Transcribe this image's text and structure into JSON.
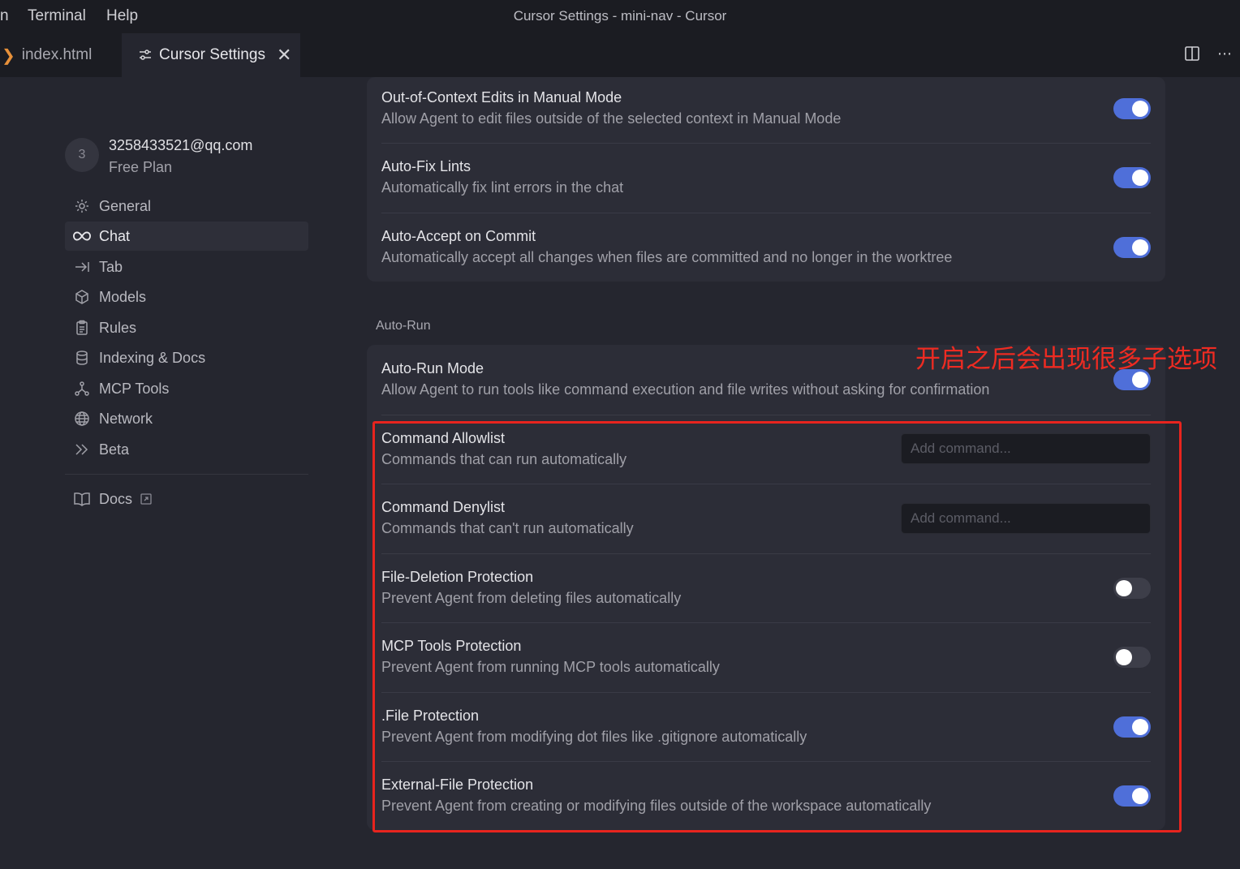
{
  "menu": {
    "fragment": "n",
    "terminal": "Terminal",
    "help": "Help"
  },
  "window_title": "Cursor Settings - mini-nav - Cursor",
  "tabs": [
    {
      "label": "index.html",
      "icon": "chevron-right-icon"
    },
    {
      "label": "Cursor Settings",
      "icon": "sliders-icon",
      "active": true
    }
  ],
  "tab_actions": [
    "split-editor-icon",
    "more-icon"
  ],
  "account": {
    "avatar_initial": "3",
    "email": "3258433521@qq.com",
    "plan": "Free Plan"
  },
  "nav": [
    {
      "label": "General",
      "icon": "gear-icon"
    },
    {
      "label": "Chat",
      "icon": "infinity-icon",
      "active": true
    },
    {
      "label": "Tab",
      "icon": "tab-arrow-icon"
    },
    {
      "label": "Models",
      "icon": "cube-icon"
    },
    {
      "label": "Rules",
      "icon": "clipboard-icon"
    },
    {
      "label": "Indexing & Docs",
      "icon": "database-icon"
    },
    {
      "label": "MCP Tools",
      "icon": "nodes-icon"
    },
    {
      "label": "Network",
      "icon": "globe-icon"
    },
    {
      "label": "Beta",
      "icon": "double-chevron-icon"
    }
  ],
  "docs": {
    "label": "Docs",
    "icon": "book-icon",
    "external_icon": "external-link-icon"
  },
  "top_card": [
    {
      "title": "Out-of-Context Edits in Manual Mode",
      "desc": "Allow Agent to edit files outside of the selected context in Manual Mode",
      "enabled": true
    },
    {
      "title": "Auto-Fix Lints",
      "desc": "Automatically fix lint errors in the chat",
      "enabled": true
    },
    {
      "title": "Auto-Accept on Commit",
      "desc": "Automatically accept all changes when files are committed and no longer in the worktree",
      "enabled": true
    }
  ],
  "auto_run": {
    "section_label": "Auto-Run",
    "mode": {
      "title": "Auto-Run Mode",
      "desc": "Allow Agent to run tools like command execution and file writes without asking for confirmation",
      "enabled": true
    },
    "allowlist": {
      "title": "Command Allowlist",
      "desc": "Commands that can run automatically",
      "placeholder": "Add command..."
    },
    "denylist": {
      "title": "Command Denylist",
      "desc": "Commands that can't run automatically",
      "placeholder": "Add command..."
    },
    "toggles": [
      {
        "title": "File-Deletion Protection",
        "desc": "Prevent Agent from deleting files automatically",
        "enabled": false
      },
      {
        "title": "MCP Tools Protection",
        "desc": "Prevent Agent from running MCP tools automatically",
        "enabled": false
      },
      {
        "title": ".File Protection",
        "desc": "Prevent Agent from modifying dot files like .gitignore automatically",
        "enabled": true
      },
      {
        "title": "External-File Protection",
        "desc": "Prevent Agent from creating or modifying files outside of the workspace automatically",
        "enabled": true
      }
    ]
  },
  "annotation": {
    "text": "开启之后会出现很多子选项",
    "color": "#e8241e"
  },
  "colors": {
    "accent": "#4f6fd9",
    "annotation": "#e8241e",
    "tab_icon": "#e8913a"
  }
}
